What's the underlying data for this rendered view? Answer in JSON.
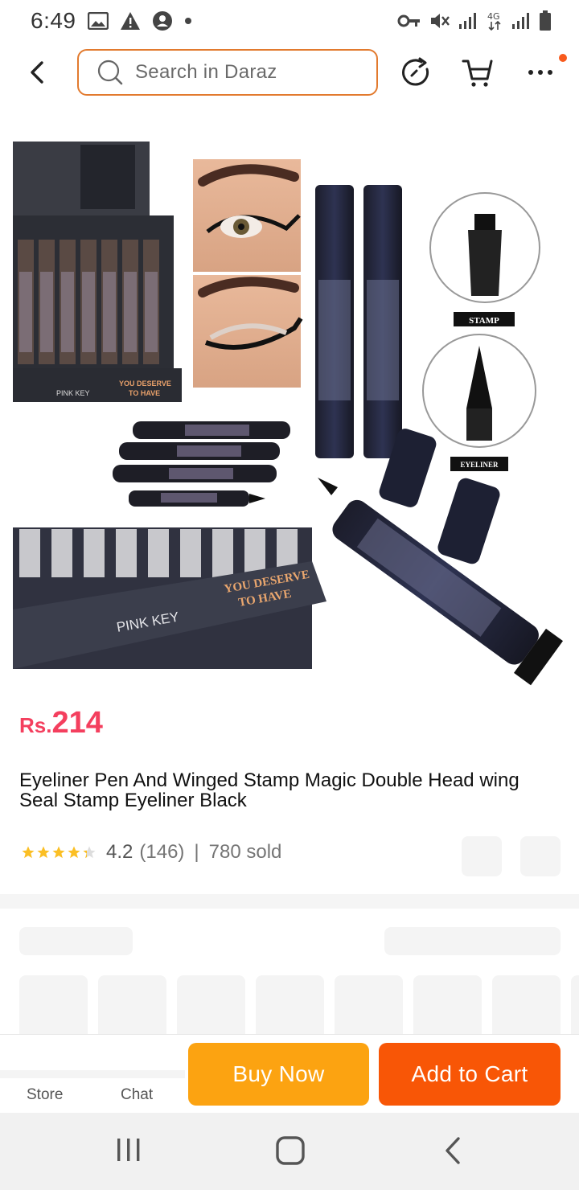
{
  "status_bar": {
    "time": "6:49",
    "network": "4G"
  },
  "search": {
    "placeholder": "Search in Daraz"
  },
  "product": {
    "price_currency": "Rs.",
    "price_amount": "214",
    "title": "Eyeliner Pen And Winged Stamp Magic Double Head wing Seal Stamp Eyeliner Black",
    "rating": "4.2",
    "reviews": "(146)",
    "separator": "|",
    "sold": "780 sold",
    "stars": 4.2,
    "image_text": {
      "stamp_label": "STAMP",
      "eyeliner_label": "EYELINER",
      "brand": "PINK KEY",
      "slogan_line1": "YOU DESERVE",
      "slogan_line2": "TO HAVE"
    }
  },
  "bottom_bar": {
    "store_label": "Store",
    "chat_label": "Chat",
    "buy_now": "Buy Now",
    "add_to_cart": "Add to Cart"
  },
  "colors": {
    "accent": "#f85606",
    "buy_now": "#fca311",
    "price": "#f43f5e",
    "star": "#fbbf24",
    "search_border": "#e27a2e"
  },
  "icons": [
    "back-icon",
    "search-icon",
    "history-icon",
    "cart-icon",
    "more-icon",
    "recent-apps-icon",
    "home-icon",
    "nav-back-icon"
  ]
}
